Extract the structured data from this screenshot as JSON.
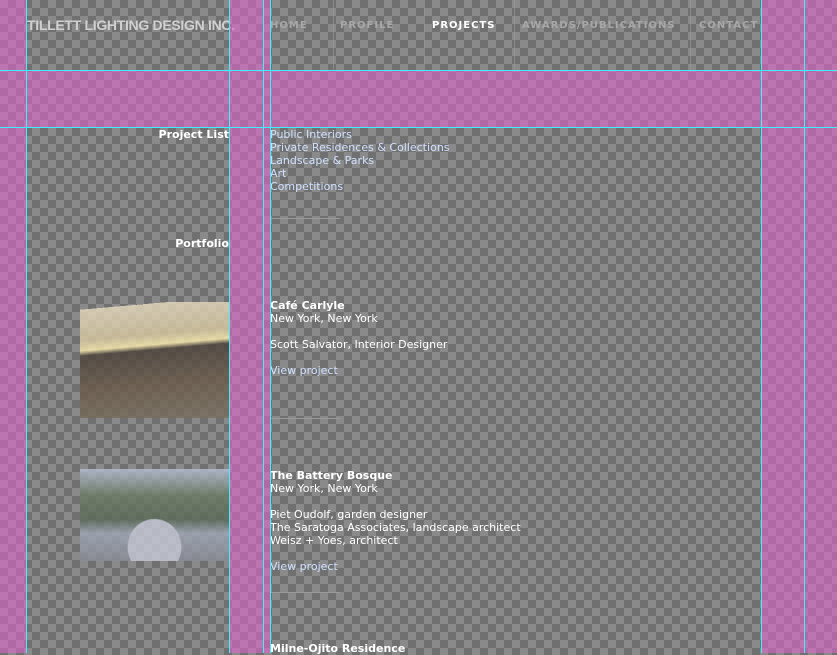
{
  "header": {
    "logo": "TILLETT LIGHTING DESIGN INC.",
    "nav": [
      {
        "label": "HOME",
        "active": false
      },
      {
        "label": "PROFILE",
        "active": false
      },
      {
        "label": "PROJECTS",
        "active": true
      },
      {
        "label": "AWARDS/PUBLICATIONS",
        "active": false
      },
      {
        "label": "CONTACT",
        "active": false
      }
    ]
  },
  "sidebar": {
    "project_list_label": "Project List",
    "portfolio_label": "Portfolio"
  },
  "project_list": [
    "Public Interiors",
    "Private Residences & Collections",
    "Landscape & Parks",
    "Art",
    "Competitions"
  ],
  "projects": [
    {
      "title": "Café Carlyle",
      "location": "New York, New York",
      "credits": [
        "Scott Salvator, Interior Designer"
      ],
      "link": "View project"
    },
    {
      "title": "The Battery Bosque",
      "location": "New York, New York",
      "credits": [
        "Piet Oudolf, garden designer",
        "The Saratoga Associates, landscape architect",
        "Weisz + Yoes, architect"
      ],
      "link": "View project"
    },
    {
      "title": "Milne-Ojito Residence"
    }
  ],
  "colors": {
    "guide_column": "#e664d2",
    "guide_line": "#3ef0ff",
    "link": "#cfe0ff"
  }
}
